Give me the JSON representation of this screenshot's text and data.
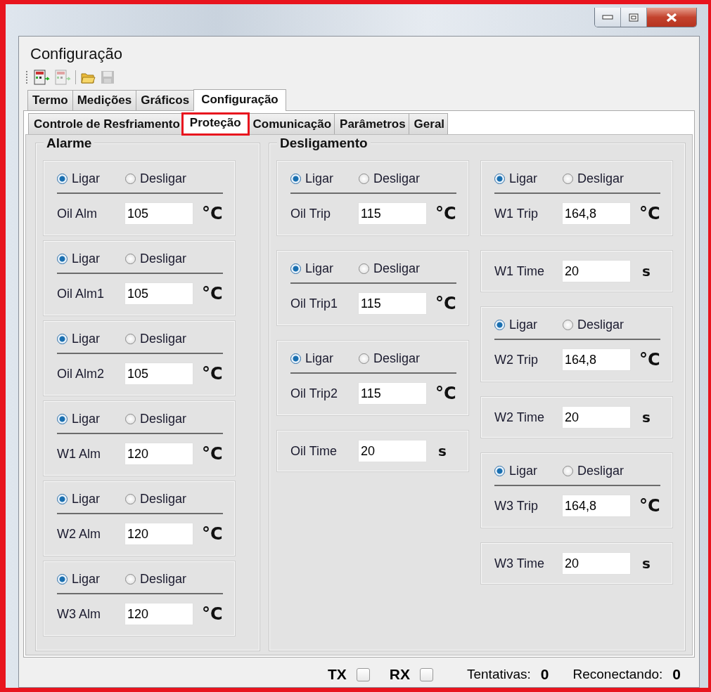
{
  "window": {
    "title": "Configuração"
  },
  "toolbar": [
    {
      "kind": "device",
      "disabled": false
    },
    {
      "kind": "device",
      "disabled": true
    },
    {
      "kind": "separator"
    },
    {
      "kind": "folder",
      "disabled": false
    },
    {
      "kind": "save",
      "disabled": true
    }
  ],
  "tabs": [
    {
      "label": "Termo",
      "selected": false
    },
    {
      "label": "Medições",
      "selected": false
    },
    {
      "label": "Gráficos",
      "selected": false
    },
    {
      "label": "Configuração",
      "selected": true
    }
  ],
  "subtabs": [
    {
      "label": "Controle de Resfriamento",
      "selected": false
    },
    {
      "label": "Proteção",
      "selected": true
    },
    {
      "label": "Comunicação",
      "selected": false
    },
    {
      "label": "Parâmetros",
      "selected": false
    },
    {
      "label": "Geral",
      "selected": false
    }
  ],
  "groups": [
    {
      "title": "Alarme",
      "columns": [
        [
          {
            "kind": "toggle",
            "options": [
              {
                "label": "Ligar",
                "selected": true
              },
              {
                "label": "Desligar",
                "selected": false
              }
            ],
            "label": "Oil Alm",
            "value": "105",
            "unit": "°C"
          },
          {
            "kind": "toggle",
            "options": [
              {
                "label": "Ligar",
                "selected": true
              },
              {
                "label": "Desligar",
                "selected": false
              }
            ],
            "label": "Oil Alm1",
            "value": "105",
            "unit": "°C"
          },
          {
            "kind": "toggle",
            "options": [
              {
                "label": "Ligar",
                "selected": true
              },
              {
                "label": "Desligar",
                "selected": false
              }
            ],
            "label": "Oil Alm2",
            "value": "105",
            "unit": "°C"
          },
          {
            "kind": "toggle",
            "options": [
              {
                "label": "Ligar",
                "selected": true
              },
              {
                "label": "Desligar",
                "selected": false
              }
            ],
            "label": "W1 Alm",
            "value": "120",
            "unit": "°C"
          },
          {
            "kind": "toggle",
            "options": [
              {
                "label": "Ligar",
                "selected": true
              },
              {
                "label": "Desligar",
                "selected": false
              }
            ],
            "label": "W2 Alm",
            "value": "120",
            "unit": "°C"
          },
          {
            "kind": "toggle",
            "options": [
              {
                "label": "Ligar",
                "selected": true
              },
              {
                "label": "Desligar",
                "selected": false
              }
            ],
            "label": "W3 Alm",
            "value": "120",
            "unit": "°C"
          }
        ]
      ]
    },
    {
      "title": "Desligamento",
      "columns": [
        [
          {
            "kind": "toggle",
            "options": [
              {
                "label": "Ligar",
                "selected": true
              },
              {
                "label": "Desligar",
                "selected": false
              }
            ],
            "label": "Oil Trip",
            "value": "115",
            "unit": "°C"
          },
          {
            "kind": "toggle",
            "options": [
              {
                "label": "Ligar",
                "selected": true
              },
              {
                "label": "Desligar",
                "selected": false
              }
            ],
            "label": "Oil Trip1",
            "value": "115",
            "unit": "°C"
          },
          {
            "kind": "toggle",
            "options": [
              {
                "label": "Ligar",
                "selected": true
              },
              {
                "label": "Desligar",
                "selected": false
              }
            ],
            "label": "Oil Trip2",
            "value": "115",
            "unit": "°C"
          },
          {
            "kind": "time",
            "label": "Oil Time",
            "value": "20",
            "unit": "s"
          }
        ],
        [
          {
            "kind": "toggle",
            "options": [
              {
                "label": "Ligar",
                "selected": true
              },
              {
                "label": "Desligar",
                "selected": false
              }
            ],
            "label": "W1 Trip",
            "value": "164,8",
            "unit": "°C"
          },
          {
            "kind": "time",
            "label": "W1 Time",
            "value": "20",
            "unit": "s"
          },
          {
            "kind": "toggle",
            "options": [
              {
                "label": "Ligar",
                "selected": true
              },
              {
                "label": "Desligar",
                "selected": false
              }
            ],
            "label": "W2 Trip",
            "value": "164,8",
            "unit": "°C"
          },
          {
            "kind": "time",
            "label": "W2 Time",
            "value": "20",
            "unit": "s"
          },
          {
            "kind": "toggle",
            "options": [
              {
                "label": "Ligar",
                "selected": true
              },
              {
                "label": "Desligar",
                "selected": false
              }
            ],
            "label": "W3 Trip",
            "value": "164,8",
            "unit": "°C"
          },
          {
            "kind": "time",
            "label": "W3 Time",
            "value": "20",
            "unit": "s"
          }
        ]
      ]
    }
  ],
  "status_bar": {
    "indicators": [
      {
        "label": "TX",
        "checked": false
      },
      {
        "label": "RX",
        "checked": false
      }
    ],
    "counters": [
      {
        "label": "Tentativas:",
        "value": "0"
      },
      {
        "label": "Reconectando:",
        "value": "0"
      }
    ]
  }
}
